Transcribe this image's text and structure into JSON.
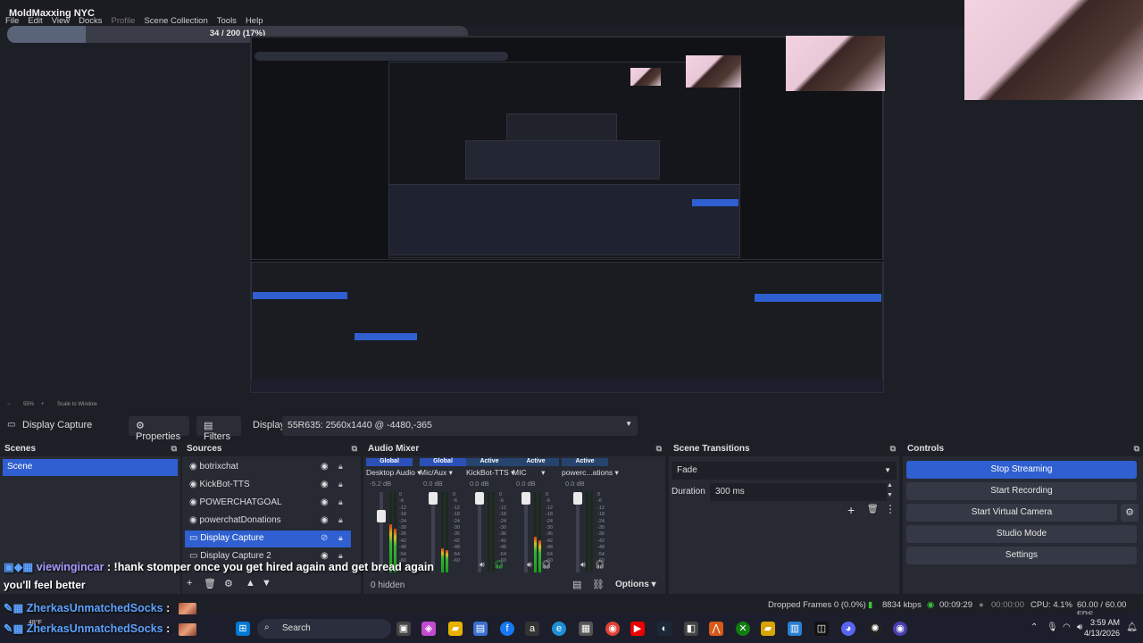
{
  "window": {
    "stream_title": "MoldMaxxing NYC",
    "menu": [
      "File",
      "Edit",
      "View",
      "Docks",
      "Profile",
      "Scene Collection",
      "Tools",
      "Help"
    ]
  },
  "progress": {
    "text": "34 / 200 (17%)",
    "fraction": 0.17
  },
  "preview_status": {
    "zoom": "55%",
    "mode": "Scale to Window"
  },
  "source_toolbar": {
    "source": "Display Capture",
    "properties": "Properties",
    "filters": "Filters",
    "display_label": "Display",
    "display_value": "55R635: 2560x1440 @ -4480,-365"
  },
  "scenes": {
    "title": "Scenes",
    "items": [
      "Scene"
    ]
  },
  "sources": {
    "title": "Sources",
    "items": [
      "botrixchat",
      "KickBot-TTS",
      "POWERCHATGOAL",
      "powerchatDonations",
      "Display Capture",
      "Display Capture 2"
    ]
  },
  "mixer": {
    "title": "Audio Mixer",
    "hidden": "0 hidden",
    "channels": [
      {
        "tag": "Global",
        "name": "Desktop Audio",
        "db": "-5.2 dB"
      },
      {
        "tag": "Global",
        "name": "Mic/Aux",
        "db": "0.0 dB"
      },
      {
        "tag": "Active",
        "name": "KickBot-TTS",
        "db": "0.0 dB"
      },
      {
        "tag": "Active",
        "name": "MIC",
        "db": "0.0 dB"
      },
      {
        "tag": "Active",
        "name": "powerc...ations",
        "db": "0.0 dB"
      }
    ],
    "scale": [
      "0",
      "-6",
      "-12",
      "-18",
      "-24",
      "-30",
      "-36",
      "-42",
      "-48",
      "-54",
      "-60"
    ]
  },
  "transitions": {
    "title": "Scene Transitions",
    "transition": "Fade",
    "duration_label": "Duration",
    "duration": "300 ms"
  },
  "controls": {
    "title": "Controls",
    "buttons": [
      "Stop Streaming",
      "Start Recording",
      "Start Virtual Camera",
      "Studio Mode",
      "Settings"
    ]
  },
  "options_label": "Options",
  "status": {
    "dropped": "Dropped Frames 0 (0.0%)",
    "bitrate": "8834 kbps",
    "stream_time": "00:09:29",
    "rec_time": "00:00:00",
    "cpu": "CPU: 4.1%",
    "fps": "60.00 / 60.00 FPS"
  },
  "chat": [
    {
      "user": "viewingincar",
      "text": " : !hank stomper once you get hired again and get bread again"
    },
    {
      "text": "you'll feel better"
    },
    {
      "user": "ZherkasUnmatchedSocks",
      "text": " :"
    },
    {
      "user": "ZherkasUnmatchedSocks",
      "text": " :"
    }
  ],
  "taskbar": {
    "search": "Search",
    "weather": "48°F",
    "time": "3:59 AM",
    "date": "4/13/2026"
  },
  "colors": {
    "accent": "#2f5fd0",
    "panel": "#272a33",
    "background": "#1d1f26"
  }
}
